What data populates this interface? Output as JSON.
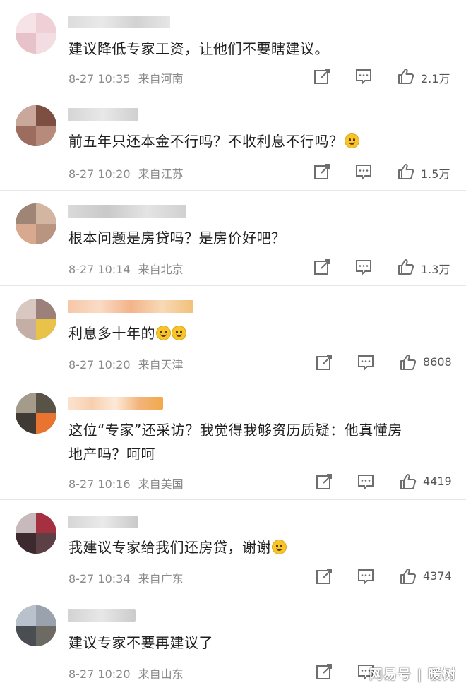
{
  "comments": [
    {
      "text": "建议降低专家工资，让他们不要瞎建议。",
      "time": "8-27 10:35",
      "location": "来自河南",
      "likes": "2.1万"
    },
    {
      "text": "前五年只还本金不行吗？不收利息不行吗？",
      "emoji": "laughing-tears-emoji",
      "time": "8-27 10:20",
      "location": "来自江苏",
      "likes": "1.5万"
    },
    {
      "text": "根本问题是房贷吗？是房价好吧？",
      "time": "8-27 10:14",
      "location": "来自北京",
      "likes": "1.3万"
    },
    {
      "text": "利息多十年的",
      "emoji": "smile-emoji-x2",
      "time": "8-27 10:20",
      "location": "来自天津",
      "likes": "8608"
    },
    {
      "text_line1": "这位“专家”还采访？我觉得我够资历质疑：他真懂房",
      "text_line2": "地产吗？呵呵",
      "time": "8-27 10:16",
      "location": "来自美国",
      "likes": "4419"
    },
    {
      "text": "我建议专家给我们还房贷，谢谢",
      "emoji": "shy-emoji",
      "time": "8-27 10:34",
      "location": "来自广东",
      "likes": "4374"
    },
    {
      "text": "建议专家不要再建议了",
      "time": "8-27 10:20",
      "location": "来自山东",
      "likes": ""
    }
  ],
  "watermark": "网易号 | 暖树",
  "colors": {
    "meta_text": "#8a8a8a",
    "body_text": "#1f1f1f",
    "icon_stroke": "#6e6e6e",
    "divider": "#e6e6e6"
  }
}
